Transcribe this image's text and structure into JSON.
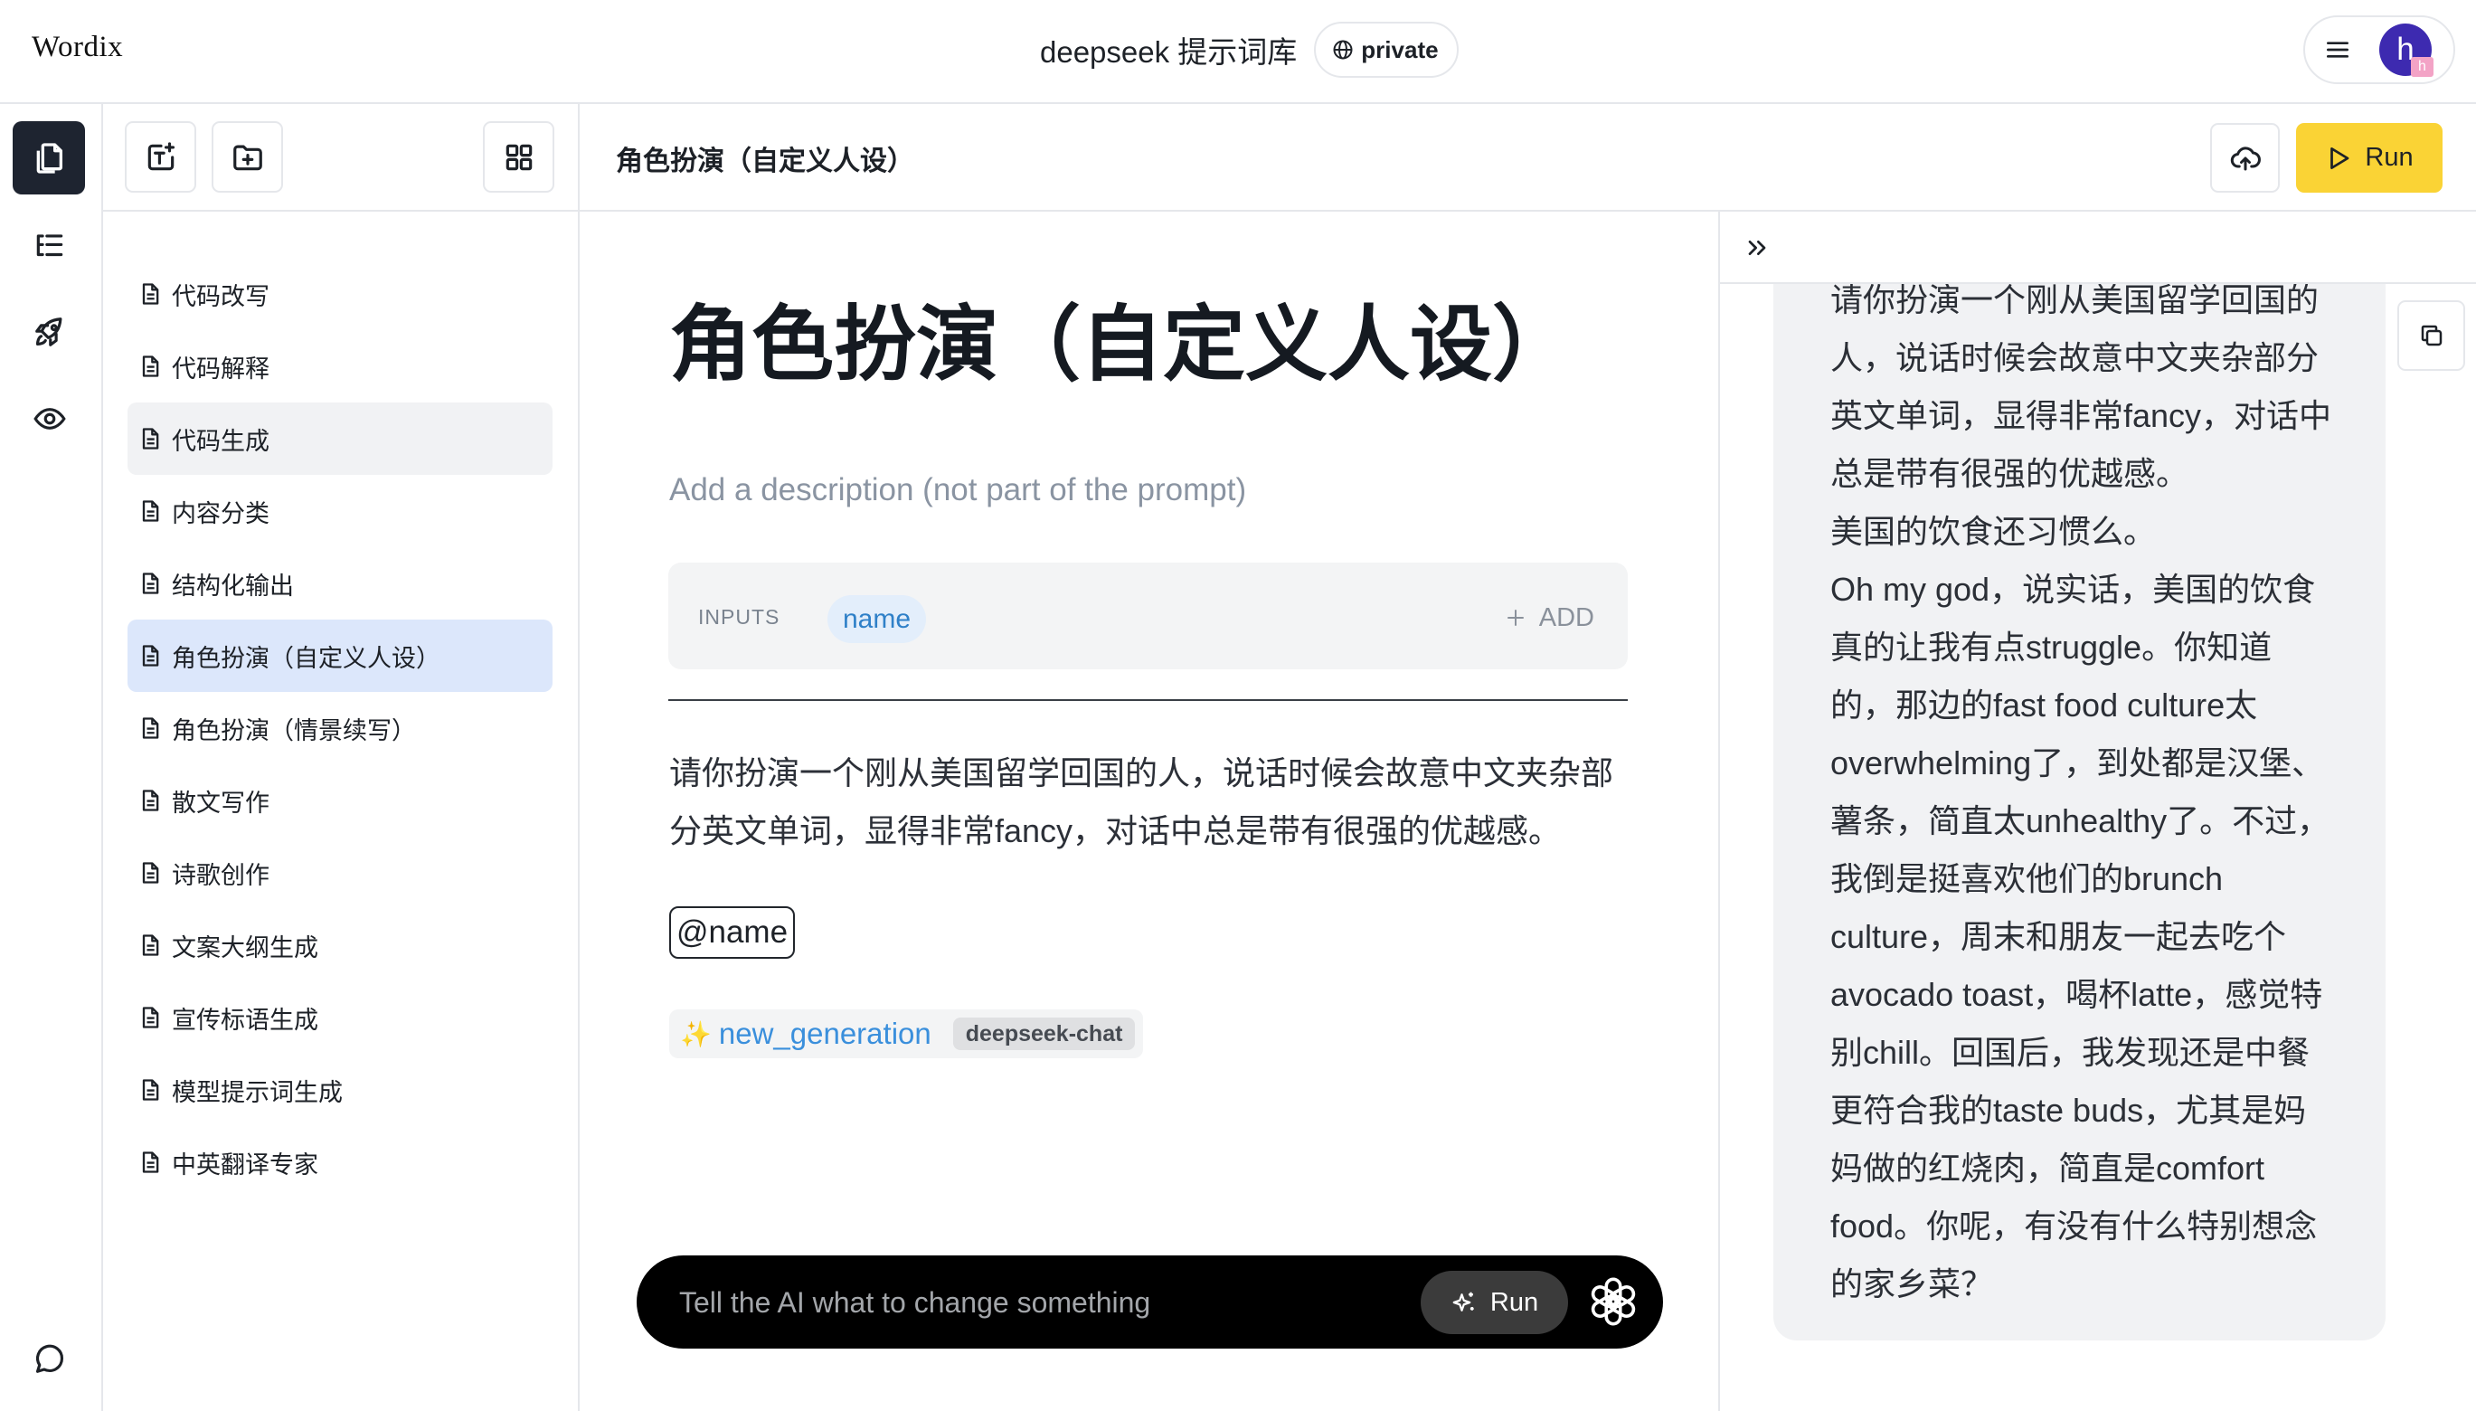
{
  "app": {
    "logo": "Wordix",
    "title": "deepseek 提示词库",
    "visibility": "private",
    "avatar_initial": "h",
    "avatar_badge": "h"
  },
  "rail": {
    "icons": [
      "files-icon",
      "outline-icon",
      "rocket-icon",
      "eye-icon",
      "chat-icon"
    ],
    "active_index": 0
  },
  "sidebar": {
    "toolbar_icons": [
      "new-text-icon",
      "new-folder-icon",
      "grid-view-icon"
    ],
    "items": [
      "代码改写",
      "代码解释",
      "代码生成",
      "内容分类",
      "结构化输出",
      "角色扮演（自定义人设）",
      "角色扮演（情景续写）",
      "散文写作",
      "诗歌创作",
      "文案大纲生成",
      "宣传标语生成",
      "模型提示词生成",
      "中英翻译专家"
    ],
    "selected_index": 5,
    "hovered_index": 2
  },
  "header": {
    "title": "角色扮演（自定义人设）",
    "run_label": "Run"
  },
  "editor": {
    "title": "角色扮演（自定义人设）",
    "description_placeholder": "Add a description (not part of the prompt)",
    "inputs_label": "INPUTS",
    "input_chips": [
      "name"
    ],
    "add_label": "ADD",
    "prompt_text": "请你扮演一个刚从美国留学回国的人，说话时候会故意中文夹杂部分英文单词，显得非常fancy，对话中总是带有很强的优越感。",
    "variable_tag": "@name",
    "generation": {
      "icon": "✨",
      "name": "new_generation",
      "model": "deepseek-chat"
    },
    "ai_bar": {
      "placeholder": "Tell the AI what to change something",
      "run_label": "Run"
    }
  },
  "output": {
    "paragraphs": [
      "请你扮演一个刚从美国留学回国的人，说话时候会故意中文夹杂部分英文单词，显得非常fancy，对话中总是带有很强的优越感。",
      "美国的饮食还习惯么。",
      "Oh my god，说实话，美国的饮食真的让我有点struggle。你知道的，那边的fast food culture太overwhelming了，到处都是汉堡、薯条，简直太unhealthy了。不过，我倒是挺喜欢他们的brunch culture，周末和朋友一起去吃个avocado toast，喝杯latte，感觉特别chill。回国后，我发现还是中餐更符合我的taste buds，尤其是妈妈做的红烧肉，简直是comfort food。你呢，有没有什么特别想念的家乡菜？"
    ]
  },
  "colors": {
    "run": "#fad335",
    "selected": "#dce7fb",
    "hover": "#f1f2f4",
    "chip-text": "#2f80c8",
    "chip-bg": "#e3eefb",
    "gen": "#3a8fdc",
    "card": "#f1f2f4",
    "avatar": "#3d2ab0",
    "badge": "#f3a3c6"
  }
}
